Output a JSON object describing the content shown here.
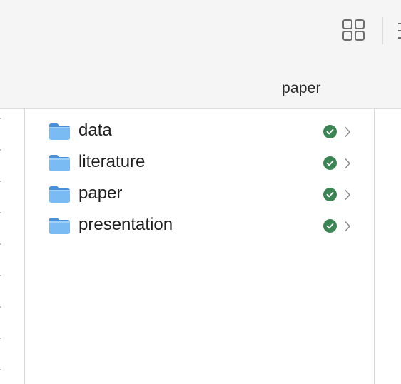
{
  "column_header": {
    "title": "paper"
  },
  "toolbar": {
    "view_icon": "grid-view-icon",
    "more_icon": "more-options-icon"
  },
  "items": [
    {
      "name": "data",
      "kind": "folder",
      "status": "synced"
    },
    {
      "name": "literature",
      "kind": "folder",
      "status": "synced"
    },
    {
      "name": "paper",
      "kind": "folder",
      "status": "synced"
    },
    {
      "name": "presentation",
      "kind": "folder",
      "status": "synced"
    }
  ],
  "colors": {
    "folder_blue": "#6fb3ee",
    "folder_tab": "#4a90d9",
    "synced_green": "#3b8554",
    "chevron_gray": "#8e8e8e",
    "toolbar_bg": "#f5f5f5"
  }
}
